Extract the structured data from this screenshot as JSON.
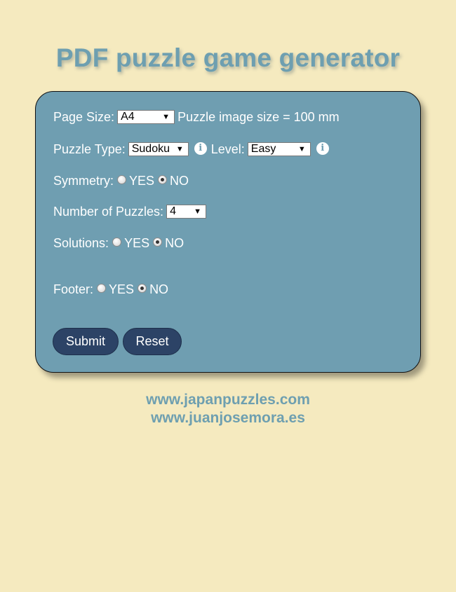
{
  "title": "PDF puzzle game generator",
  "form": {
    "page_size": {
      "label": "Page Size:",
      "value": "A4",
      "image_size_text": "Puzzle image size = 100 mm"
    },
    "puzzle_type": {
      "label": "Puzzle Type:",
      "value": "Sudoku",
      "info_icon": "info-icon"
    },
    "level": {
      "label": "Level:",
      "value": "Easy",
      "info_icon": "info-icon"
    },
    "symmetry": {
      "label": "Symmetry:",
      "yes": "YES",
      "no": "NO",
      "selected": "NO"
    },
    "number_of_puzzles": {
      "label": "Number of Puzzles:",
      "value": "4"
    },
    "solutions": {
      "label": "Solutions:",
      "yes": "YES",
      "no": "NO",
      "selected": "NO"
    },
    "footer": {
      "label": "Footer:",
      "yes": "YES",
      "no": "NO",
      "selected": "NO"
    },
    "buttons": {
      "submit": "Submit",
      "reset": "Reset"
    }
  },
  "links": {
    "site1": "www.japanpuzzles.com",
    "site2": "www.juanjosemora.es"
  },
  "colors": {
    "background": "#f5eabf",
    "panel": "#6f9eb1",
    "title": "#6e9fb0",
    "button": "#2c4366"
  }
}
